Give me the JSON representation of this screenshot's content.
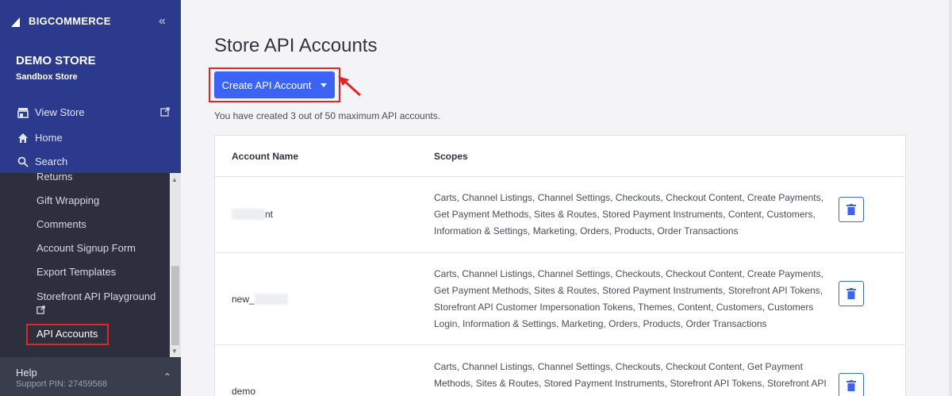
{
  "sidebar": {
    "brand_prefix": "BIG",
    "brand_suffix": "COMMERCE",
    "collapse_glyph": "«",
    "store_name": "DEMO STORE",
    "store_sub": "Sandbox Store",
    "nav": [
      {
        "label": "View Store",
        "icon": "storefront-icon"
      },
      {
        "label": "Home",
        "icon": "home-icon"
      },
      {
        "label": "Search",
        "icon": "search-icon"
      }
    ],
    "links": [
      "Returns",
      "Gift Wrapping",
      "Comments",
      "Account Signup Form",
      "Export Templates",
      "Storefront API Playground",
      "API Accounts"
    ],
    "help_label": "Help",
    "help_pin": "Support PIN: 27459568"
  },
  "main": {
    "title": "Store API Accounts",
    "create_label": "Create API Account",
    "quota": "You have created 3 out of 50 maximum API accounts.",
    "columns": [
      "Account Name",
      "Scopes"
    ],
    "rows": [
      {
        "name_visible": "nt",
        "scopes": [
          "Carts, Channel Listings, Channel Settings, Checkouts, Checkout Content, Create Payments,",
          "Get Payment Methods, Sites & Routes, Stored Payment Instruments, Content, Customers,",
          "Information & Settings, Marketing, Orders, Products, Order Transactions"
        ]
      },
      {
        "name_visible": "new_",
        "scopes": [
          "Carts, Channel Listings, Channel Settings, Checkouts, Checkout Content, Create Payments,",
          "Get Payment Methods, Sites & Routes, Stored Payment Instruments, Storefront API Tokens,",
          "Storefront API Customer Impersonation Tokens, Themes, Content, Customers, Customers",
          "Login, Information & Settings, Marketing, Orders, Products, Order Transactions"
        ]
      },
      {
        "name_visible": "demo",
        "scopes": [
          "Carts, Channel Listings, Channel Settings, Checkouts, Checkout Content, Get Payment",
          "Methods, Sites & Routes, Stored Payment Instruments, Storefront API Tokens, Storefront API"
        ]
      }
    ]
  },
  "colors": {
    "sidebar_top": "#2b3a8c",
    "primary": "#3c64f4",
    "highlight": "#e0262b"
  }
}
